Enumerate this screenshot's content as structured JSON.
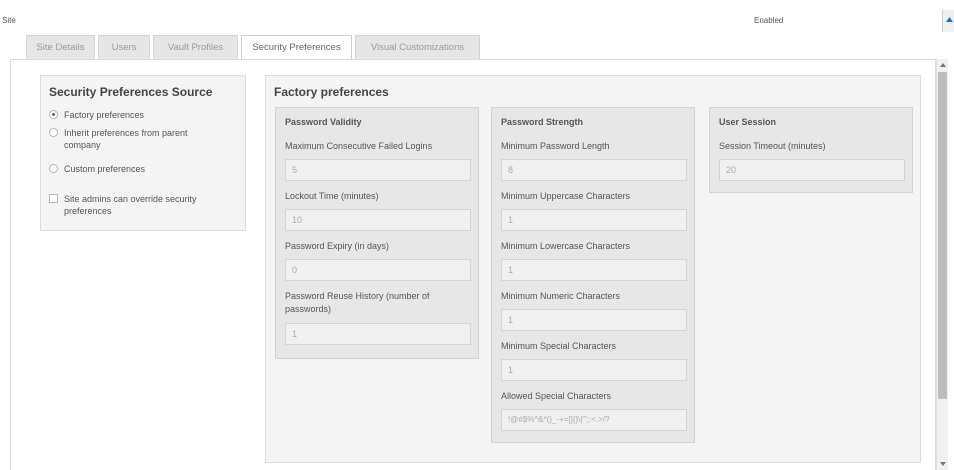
{
  "topbar": {
    "site_label": "Site",
    "status": "Enabled"
  },
  "tabs": [
    {
      "label": "Site Details"
    },
    {
      "label": "Users"
    },
    {
      "label": "Vault Profiles"
    },
    {
      "label": "Security Preferences",
      "active": true
    },
    {
      "label": "Visual Customizations"
    }
  ],
  "source": {
    "title": "Security Preferences Source",
    "options": [
      {
        "label": "Factory preferences",
        "selected": true
      },
      {
        "label": "Inherit preferences from parent company",
        "selected": false
      },
      {
        "label": "Custom preferences",
        "selected": false
      }
    ],
    "override": {
      "label": "Site admins can override security preferences",
      "checked": false
    }
  },
  "factory": {
    "title": "Factory preferences",
    "password_validity": {
      "title": "Password Validity",
      "fields": [
        {
          "label": "Maximum Consecutive Failed Logins",
          "value": "5"
        },
        {
          "label": "Lockout Time (minutes)",
          "value": "10"
        },
        {
          "label": "Password Expiry (in days)",
          "value": "0"
        },
        {
          "label": "Password Reuse History (number of passwords)",
          "value": "1"
        }
      ]
    },
    "password_strength": {
      "title": "Password Strength",
      "fields": [
        {
          "label": "Minimum Password Length",
          "value": "8"
        },
        {
          "label": "Minimum Uppercase Characters",
          "value": "1"
        },
        {
          "label": "Minimum Lowercase Characters",
          "value": "1"
        },
        {
          "label": "Minimum Numeric Characters",
          "value": "1"
        },
        {
          "label": "Minimum Special Characters",
          "value": "1"
        },
        {
          "label": "Allowed Special Characters",
          "value": "!@#$%^&*()_-+=[]{}\\|'\";:<.>/?"
        }
      ]
    },
    "user_session": {
      "title": "User Session",
      "fields": [
        {
          "label": "Session Timeout (minutes)",
          "value": "20"
        }
      ]
    }
  }
}
